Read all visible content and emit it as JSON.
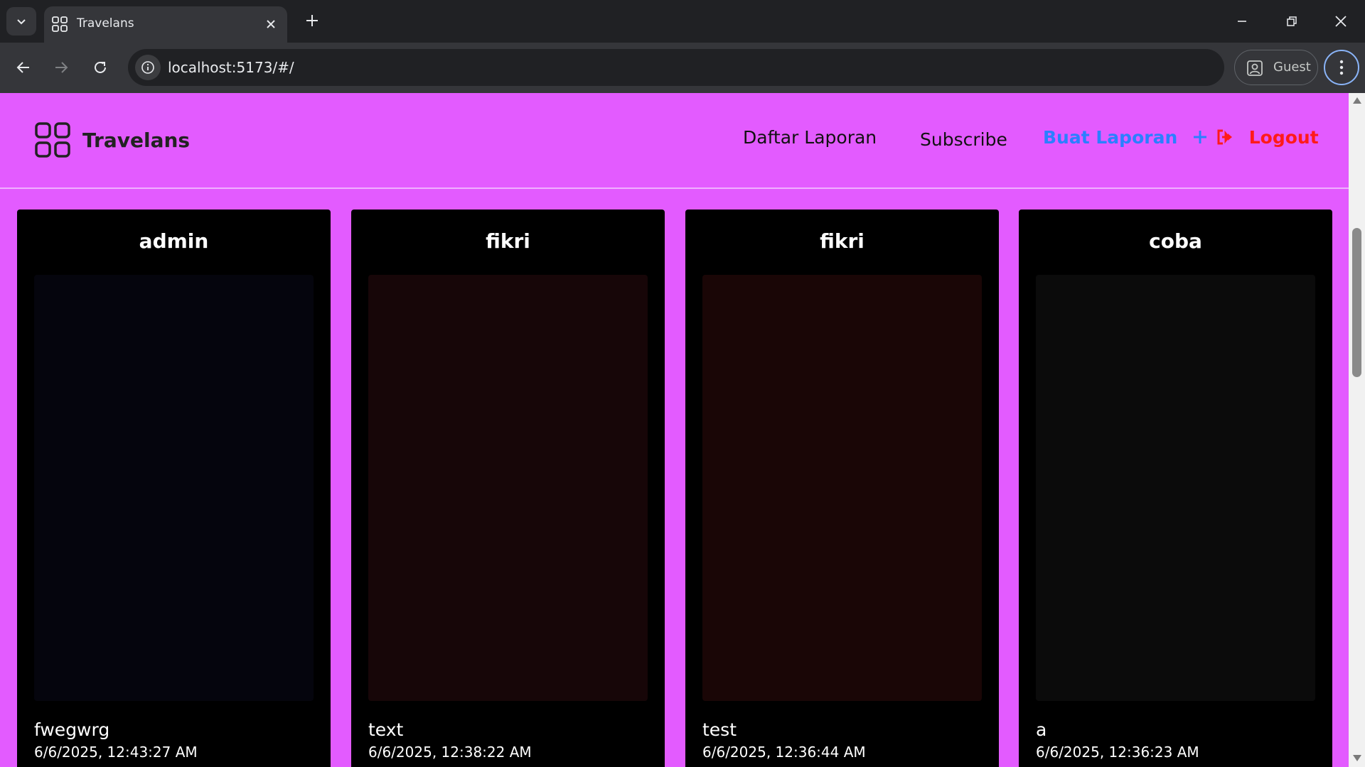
{
  "browser": {
    "tab_title": "Travelans",
    "url": "localhost:5173/#/",
    "profile_label": "Guest"
  },
  "app": {
    "brand": "Travelans",
    "nav": {
      "reports": "Daftar Laporan",
      "subscribe": "Subscribe",
      "create": "Buat Laporan",
      "logout": "Logout"
    },
    "colors": {
      "background": "#e35bff",
      "create_link": "#2b7fff",
      "logout_link": "#ff1a1a"
    }
  },
  "reports": [
    {
      "author": "admin",
      "description": "fwegwrg",
      "date": "6/6/2025, 12:43:27 AM",
      "image_tone": "#05050d"
    },
    {
      "author": "fikri",
      "description": "text",
      "date": "6/6/2025, 12:38:22 AM",
      "image_tone": "#170608"
    },
    {
      "author": "fikri",
      "description": "test",
      "date": "6/6/2025, 12:36:44 AM",
      "image_tone": "#1a0606"
    },
    {
      "author": "coba",
      "description": "a",
      "date": "6/6/2025, 12:36:23 AM",
      "image_tone": "#0b0b0b"
    }
  ]
}
